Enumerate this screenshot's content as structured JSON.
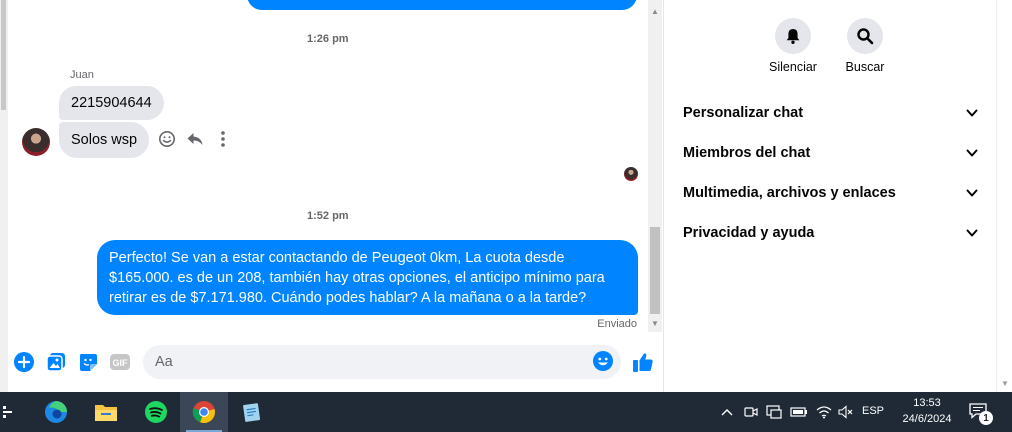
{
  "chat": {
    "timestamps": [
      "1:26 pm",
      "1:52 pm"
    ],
    "sender_name": "Juan",
    "incoming": [
      "2215904644",
      "Solos wsp"
    ],
    "outgoing": {
      "line1": "Perfecto!  Se van a estar contactando de Peugeot 0km, La cuota desde",
      "line2": "$165.000. es de un 208, también hay otras opciones, el anticipo mínimo para",
      "line3": "retirar es de $7.171.980. Cuándo podes hablar? A la mañana o a la tarde?"
    },
    "sent_status": "Enviado",
    "composer": {
      "placeholder": "Aa",
      "gif_label": "GIF"
    }
  },
  "info_panel": {
    "actions": [
      {
        "label": "Silenciar",
        "icon": "bell-icon"
      },
      {
        "label": "Buscar",
        "icon": "search-icon"
      }
    ],
    "sections": [
      "Personalizar chat",
      "Miembros del chat",
      "Multimedia, archivos y enlaces",
      "Privacidad y ayuda"
    ]
  },
  "taskbar": {
    "apps": [
      "task-view-icon",
      "edge-icon",
      "file-explorer-icon",
      "spotify-icon",
      "chrome-icon",
      "notepad-icon"
    ],
    "language": "ESP",
    "time": "13:53",
    "date": "24/6/2024",
    "notification_count": "1"
  },
  "colors": {
    "messenger_blue": "#0084ff",
    "bubble_gray": "#e4e6eb",
    "taskbar": "#1f2a36"
  }
}
